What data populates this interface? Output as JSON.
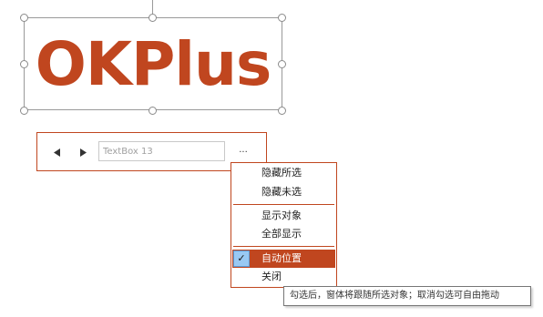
{
  "logo": {
    "text": "OKPlus",
    "color": "#c0461f"
  },
  "toolbar": {
    "prev_icon": "triangle-left",
    "next_icon": "triangle-right",
    "textbox_value": "TextBox 13",
    "more_label": "..."
  },
  "menu": {
    "items": [
      {
        "label": "隐藏所选"
      },
      {
        "label": "隐藏未选"
      },
      {
        "label": "显示对象"
      },
      {
        "label": "全部显示"
      },
      {
        "label": "自动位置",
        "checked": true,
        "active": true
      },
      {
        "label": "关闭"
      }
    ],
    "check_mark": "✓"
  },
  "tooltip": {
    "text": "勾选后，窗体将跟随所选对象；取消勾选可自由拖动"
  },
  "colors": {
    "accent": "#c0461f",
    "check_bg": "#99c9f3"
  }
}
